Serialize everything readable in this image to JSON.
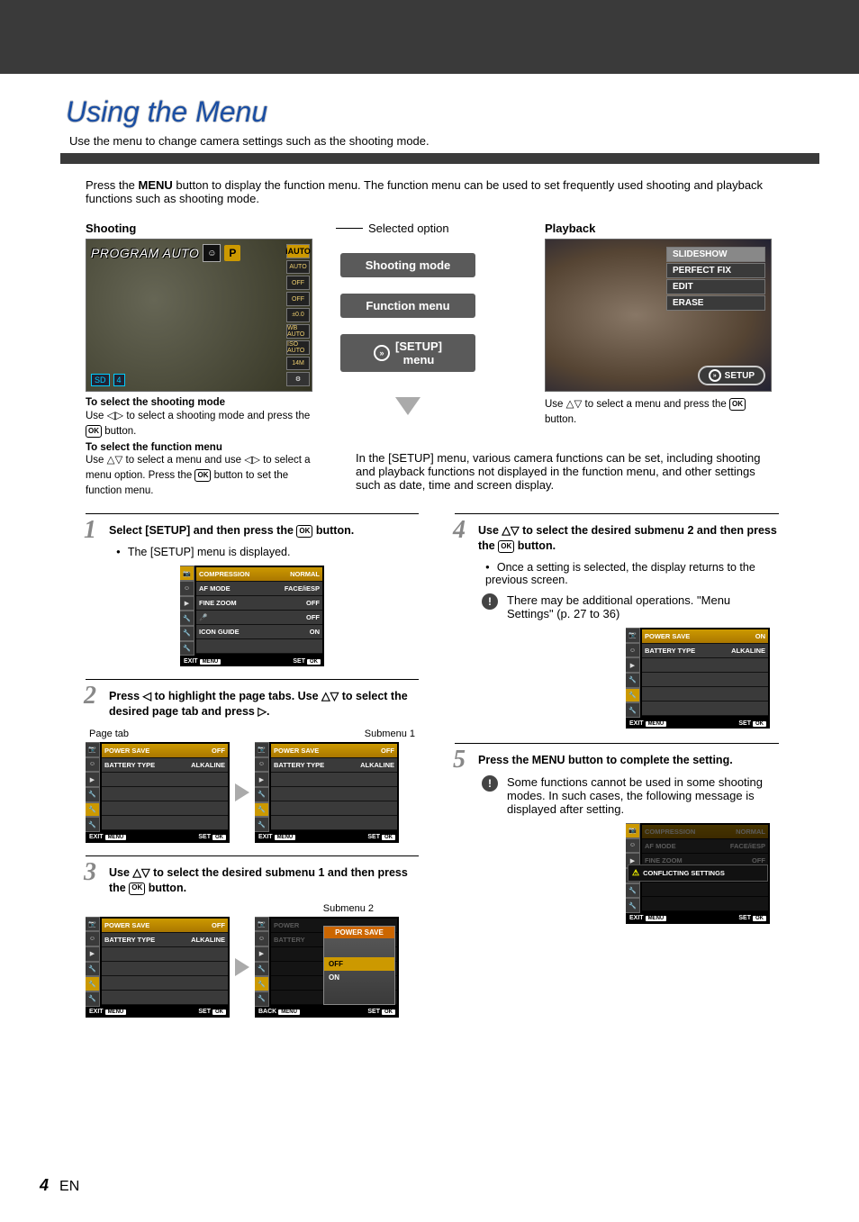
{
  "header": {
    "title": "Using the Menu",
    "subtitle": "Use the menu to change camera settings such as the shooting mode."
  },
  "intro": {
    "pre": "Press the ",
    "menu_word": "MENU",
    "post": " button to display the function menu. The function menu can be used to set frequently used shooting and playback functions such as shooting mode."
  },
  "labels": {
    "shooting": "Shooting",
    "selected_option": "Selected option",
    "playback": "Playback"
  },
  "shoot_lcd": {
    "mode_title": "PROGRAM AUTO",
    "p_badge": "P",
    "side": [
      "iAUTO",
      "AUTO",
      "OFF",
      "OFF",
      "±0.0",
      "WB AUTO",
      "ISO AUTO",
      "14M",
      "⚙"
    ],
    "corner_sd": "SD",
    "corner_count": "4"
  },
  "callouts": {
    "shooting_mode": "Shooting mode",
    "function_menu": "Function menu",
    "setup_menu_pre": "[SETUP]",
    "setup_menu_post": "menu"
  },
  "play_lcd": {
    "items": [
      "SLIDESHOW",
      "PERFECT FIX",
      "EDIT",
      "ERASE"
    ],
    "setup": "SETUP"
  },
  "instr": {
    "shoot_mode_hdr": "To select the shooting mode",
    "shoot_mode_body_pre": "Use ",
    "shoot_mode_body_mid": " to select a shooting mode and press the ",
    "shoot_mode_body_post": " button.",
    "func_menu_hdr": "To select the function menu",
    "func_menu_body": "Use △▽ to select a menu and use ◁▷ to select a menu option. Press the ",
    "func_menu_body2": " button to set the function menu.",
    "play_pre": "Use △▽ to select a menu and press the ",
    "play_post": " button."
  },
  "setup_para": "In the [SETUP] menu, various camera functions can be set, including shooting and playback functions not displayed in the function menu, and other settings such as date, time and screen display.",
  "steps": {
    "s1": {
      "n": "1",
      "txt_pre": "Select [SETUP] and then press the ",
      "txt_post": " button.",
      "bullet": "The [SETUP] menu is displayed."
    },
    "s2": {
      "n": "2",
      "txt": "Press ◁ to highlight the page tabs. Use △▽ to select the desired page tab and press ▷.",
      "cap_left": "Page tab",
      "cap_right": "Submenu 1"
    },
    "s3": {
      "n": "3",
      "txt_pre": "Use △▽ to select the desired submenu 1 and then press the ",
      "txt_post": " button.",
      "cap": "Submenu 2"
    },
    "s4": {
      "n": "4",
      "txt_pre": "Use △▽ to select the desired submenu 2 and then press the ",
      "txt_post": " button.",
      "bullet": "Once a setting is selected, the display returns to the previous screen.",
      "note": "There may be additional operations. \"Menu Settings\" (p. 27 to 36)"
    },
    "s5": {
      "n": "5",
      "txt_pre": "Press the ",
      "txt_mid": "MENU",
      "txt_post": " button to complete the setting.",
      "note": "Some functions cannot be used in some shooting modes. In such cases, the following message is displayed after setting."
    }
  },
  "menu1": {
    "rows": [
      {
        "k": "COMPRESSION",
        "v": "NORMAL",
        "hl": true
      },
      {
        "k": "AF MODE",
        "v": "FACE/iESP"
      },
      {
        "k": "FINE ZOOM",
        "v": "OFF"
      },
      {
        "k": "🎤",
        "v": "OFF"
      },
      {
        "k": "ICON GUIDE",
        "v": "ON"
      },
      {
        "k": "",
        "v": ""
      }
    ],
    "exit": "EXIT",
    "menu_b": "MENU",
    "set": "SET",
    "ok": "OK"
  },
  "menu2a": {
    "rows": [
      {
        "k": "POWER SAVE",
        "v": "OFF",
        "hl": true
      },
      {
        "k": "BATTERY TYPE",
        "v": "ALKALINE"
      },
      {
        "k": "",
        "v": ""
      },
      {
        "k": "",
        "v": ""
      },
      {
        "k": "",
        "v": ""
      },
      {
        "k": "",
        "v": ""
      }
    ]
  },
  "menu2b": {
    "rows": [
      {
        "k": "POWER SAVE",
        "v": "OFF",
        "hl": true
      },
      {
        "k": "BATTERY TYPE",
        "v": "ALKALINE"
      },
      {
        "k": "",
        "v": ""
      },
      {
        "k": "",
        "v": ""
      },
      {
        "k": "",
        "v": ""
      },
      {
        "k": "",
        "v": ""
      }
    ]
  },
  "menu3a": {
    "rows": [
      {
        "k": "POWER SAVE",
        "v": "OFF",
        "hl": true
      },
      {
        "k": "BATTERY TYPE",
        "v": "ALKALINE"
      },
      {
        "k": "",
        "v": ""
      },
      {
        "k": "",
        "v": ""
      },
      {
        "k": "",
        "v": ""
      },
      {
        "k": "",
        "v": ""
      }
    ]
  },
  "menu3b": {
    "rows": [
      {
        "k": "POWER",
        "v": ""
      },
      {
        "k": "BATTERY",
        "v": ""
      },
      {
        "k": "",
        "v": ""
      },
      {
        "k": "",
        "v": ""
      },
      {
        "k": "",
        "v": ""
      },
      {
        "k": "",
        "v": ""
      }
    ],
    "popup_header": "POWER SAVE",
    "opt1": "OFF",
    "opt2": "ON",
    "back": "BACK"
  },
  "menu4": {
    "rows": [
      {
        "k": "POWER SAVE",
        "v": "ON",
        "hl": true
      },
      {
        "k": "BATTERY TYPE",
        "v": "ALKALINE"
      },
      {
        "k": "",
        "v": ""
      },
      {
        "k": "",
        "v": ""
      },
      {
        "k": "",
        "v": ""
      },
      {
        "k": "",
        "v": ""
      }
    ]
  },
  "menu5": {
    "rows": [
      {
        "k": "COMPRESSION",
        "v": "NORMAL",
        "hl": true
      },
      {
        "k": "AF MODE",
        "v": "FACE/iESP"
      },
      {
        "k": "FINE ZOOM",
        "v": "OFF"
      },
      {
        "k": "",
        "v": ""
      },
      {
        "k": "",
        "v": ""
      },
      {
        "k": "",
        "v": ""
      }
    ],
    "conflict": "CONFLICTING SETTINGS"
  },
  "footer": {
    "page": "4",
    "lang": "EN"
  },
  "ok_label": "OK"
}
